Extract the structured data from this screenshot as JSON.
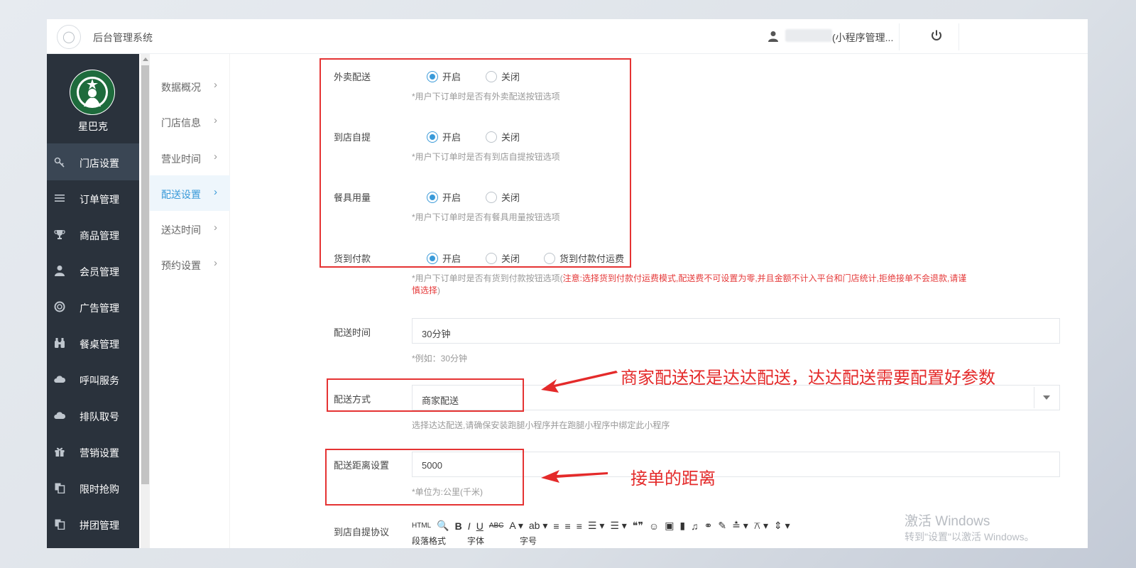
{
  "app": {
    "title": "后台管理系统"
  },
  "header": {
    "user_name": "(小程序管理..."
  },
  "store": {
    "name": "星巴克"
  },
  "sidebar": {
    "items": [
      {
        "label": "门店设置",
        "icon": "key-icon"
      },
      {
        "label": "订单管理",
        "icon": "list-icon"
      },
      {
        "label": "商品管理",
        "icon": "trophy-icon"
      },
      {
        "label": "会员管理",
        "icon": "user-icon"
      },
      {
        "label": "广告管理",
        "icon": "lifebuoy-icon"
      },
      {
        "label": "餐桌管理",
        "icon": "binoculars-icon"
      },
      {
        "label": "呼叫服务",
        "icon": "cloud-icon"
      },
      {
        "label": "排队取号",
        "icon": "cloud-icon"
      },
      {
        "label": "营销设置",
        "icon": "gift-icon"
      },
      {
        "label": "限时抢购",
        "icon": "copy-icon"
      },
      {
        "label": "拼团管理",
        "icon": "copy-icon"
      }
    ]
  },
  "submenu": {
    "items": [
      {
        "label": "数据概况"
      },
      {
        "label": "门店信息"
      },
      {
        "label": "营业时间"
      },
      {
        "label": "配送设置"
      },
      {
        "label": "送达时间"
      },
      {
        "label": "预约设置"
      }
    ]
  },
  "form": {
    "takeout": {
      "label": "外卖配送",
      "on": "开启",
      "off": "关闭",
      "hint": "*用户下订单时是否有外卖配送按钮选项"
    },
    "pickup": {
      "label": "到店自提",
      "on": "开启",
      "off": "关闭",
      "hint": "*用户下订单时是否有到店自提按钮选项"
    },
    "tableware": {
      "label": "餐具用量",
      "on": "开启",
      "off": "关闭",
      "hint": "*用户下订单时是否有餐具用量按钮选项"
    },
    "cod": {
      "label": "货到付款",
      "on": "开启",
      "off": "关闭",
      "fee": "货到付款付运费",
      "hint_a": "*用户下订单时是否有货到付款按钮选项(",
      "hint_warn_1": "注意:选择货到付款付运费模式,配送费不可设置为零,并且金额不计入平台和门店统计,拒绝接单不会退款,请谨",
      "hint_warn_2": "慎选择",
      "hint_b": ")"
    },
    "delivery_time": {
      "label": "配送时间",
      "value": "30分钟",
      "hint": "*例如：30分钟"
    },
    "delivery_method": {
      "label": "配送方式",
      "value": "商家配送",
      "hint": "选择达达配送,请确保安装跑腿小程序并在跑腿小程序中绑定此小程序"
    },
    "delivery_distance": {
      "label": "配送距离设置",
      "value": "5000",
      "hint": "*单位为:公里(千米)"
    },
    "pickup_agreement": {
      "label": "到店自提协议"
    }
  },
  "editor": {
    "row1": [
      "HTML",
      "🔍",
      "B",
      "I",
      "U",
      "ABC",
      "A ▾",
      "ab ▾",
      "≡",
      "≡",
      "≡",
      "☰ ▾",
      "☰ ▾",
      "❝❞",
      "☺",
      "▣",
      "▮",
      "♫",
      "⚭",
      "✎",
      "≛ ▾",
      "⚻ ▾",
      "⇕ ▾"
    ],
    "row2": [
      "段落格式",
      "字体",
      "字号"
    ]
  },
  "annotations": {
    "method": "商家配送还是达达配送，达达配送需要配置好参数",
    "distance": "接单的距离"
  },
  "watermark": {
    "line1": "激活 Windows",
    "line2": "转到\"设置\"以激活 Windows。"
  },
  "colors": {
    "accent": "#3a9ad9",
    "sidebar": "#2a323c",
    "annotation": "#e42a2a",
    "warning": "#e53a3a"
  }
}
